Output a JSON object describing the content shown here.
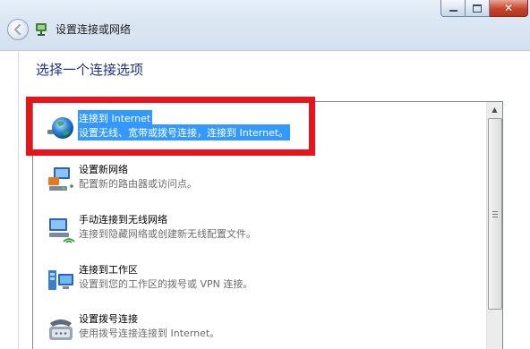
{
  "window": {
    "title": "设置连接或网络",
    "controls": {
      "minimize": "minimize-icon",
      "maximize": "maximize-icon",
      "close": "close-icon"
    }
  },
  "page": {
    "heading": "选择一个连接选项"
  },
  "options": [
    {
      "title": "连接到 Internet",
      "description": "设置无线、宽带或拨号连接，连接到 Internet。",
      "icon": "globe-network-icon",
      "selected": true
    },
    {
      "title": "设置新网络",
      "description": "配置新的路由器或访问点。",
      "icon": "new-network-icon",
      "selected": false
    },
    {
      "title": "手动连接到无线网络",
      "description": "连接到隐藏网络或创建新无线配置文件。",
      "icon": "wireless-network-icon",
      "selected": false
    },
    {
      "title": "连接到工作区",
      "description": "设置到您的工作区的拨号或 VPN 连接。",
      "icon": "workplace-icon",
      "selected": false
    },
    {
      "title": "设置拨号连接",
      "description": "使用拨号连接连接到 Internet。",
      "icon": "dialup-phone-icon",
      "selected": false
    }
  ],
  "colors": {
    "selection": "#3399ff",
    "highlight_frame": "#e8141b",
    "heading": "#1e3287"
  }
}
